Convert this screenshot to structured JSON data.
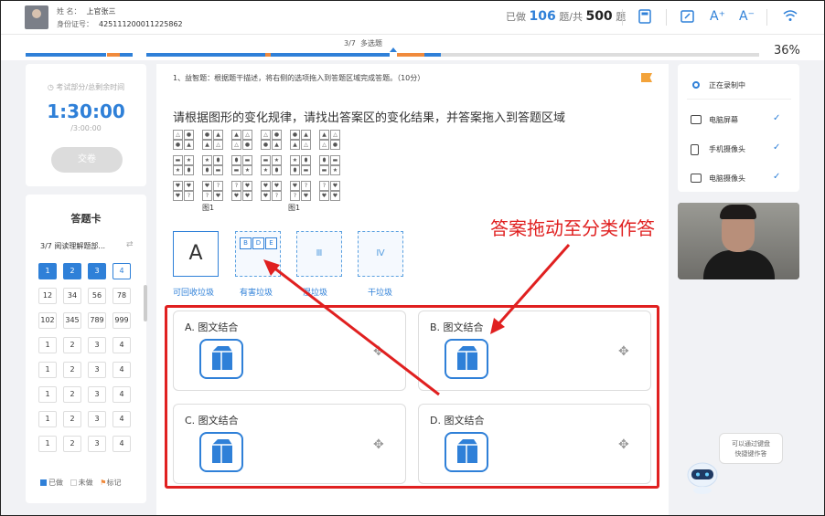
{
  "header": {
    "name_label": "姓    名：",
    "name_value": "上官张三",
    "id_label": "身份证号：",
    "id_value": "425111200011225862",
    "done_prefix": "已做",
    "done_count": "106",
    "total_mid": "题/共",
    "total_count": "500",
    "total_suffix": "题",
    "icons": [
      "calculator-icon",
      "draft-icon",
      "font-increase-icon",
      "font-decrease-icon",
      "wifi-icon"
    ],
    "font_plus": "A⁺",
    "font_minus": "A⁻"
  },
  "progress": {
    "section": "3/7",
    "section_name": "多选题",
    "percent": "36%",
    "percent_value": 36,
    "colors": {
      "done": "#2f80d8",
      "mark": "#f08a3c",
      "rest": "#dddddd"
    }
  },
  "timer": {
    "label": "考试部分/总剩余时间",
    "remaining": "1:30:00",
    "total": "/3:00:00",
    "submit_label": "交卷"
  },
  "answer_card": {
    "title": "答题卡",
    "section": "3/7  阅读理解题部...",
    "rows": [
      [
        "1",
        "2",
        "3",
        "4"
      ],
      [
        "12",
        "34",
        "56",
        "78"
      ],
      [
        "102",
        "345",
        "789",
        "999"
      ],
      [
        "1",
        "2",
        "3",
        "4"
      ],
      [
        "1",
        "2",
        "3",
        "4"
      ],
      [
        "1",
        "2",
        "3",
        "4"
      ],
      [
        "1",
        "2",
        "3",
        "4"
      ],
      [
        "1",
        "2",
        "3",
        "4"
      ]
    ],
    "done_cells": [
      0,
      1,
      2
    ],
    "current_cell": 3,
    "legend": {
      "done": "已做",
      "undone": "未做",
      "marked": "标记"
    }
  },
  "question": {
    "title": "1、益智题：根据题干描述，将右侧的选项拖入到答题区域完成答题。（10分）",
    "text": "请根据图形的变化规律，请找出答案区的变化结果，并答案拖入到答题区域",
    "figure_label_1": "图1",
    "figure_label_2": "图1",
    "figure_cells": [
      [
        "△",
        "●",
        "▲"
      ],
      [
        "▬",
        "★",
        "⬮"
      ],
      [
        "♥",
        "♥",
        "?"
      ]
    ]
  },
  "bins": [
    {
      "symbol": "A",
      "label": "可回收垃圾"
    },
    {
      "symbol": "",
      "label": "有害垃圾",
      "cards": [
        "B",
        "D",
        "E"
      ]
    },
    {
      "symbol": "Ⅲ",
      "label": "湿垃圾"
    },
    {
      "symbol": "Ⅳ",
      "label": "干垃圾"
    }
  ],
  "options": [
    {
      "label": "A. 图文结合"
    },
    {
      "label": "B. 图文结合"
    },
    {
      "label": "C. 图文结合"
    },
    {
      "label": "D. 图文结合"
    }
  ],
  "annotation": "答案拖动至分类作答",
  "recording": {
    "status": "正在录制中",
    "items": [
      {
        "label": "电脑屏幕",
        "icon": "monitor-icon"
      },
      {
        "label": "手机摄像头",
        "icon": "phone-camera-icon"
      },
      {
        "label": "电脑摄像头",
        "icon": "webcam-icon"
      }
    ]
  },
  "assistant_tip": "可以通过键盘\n快捷键作答"
}
